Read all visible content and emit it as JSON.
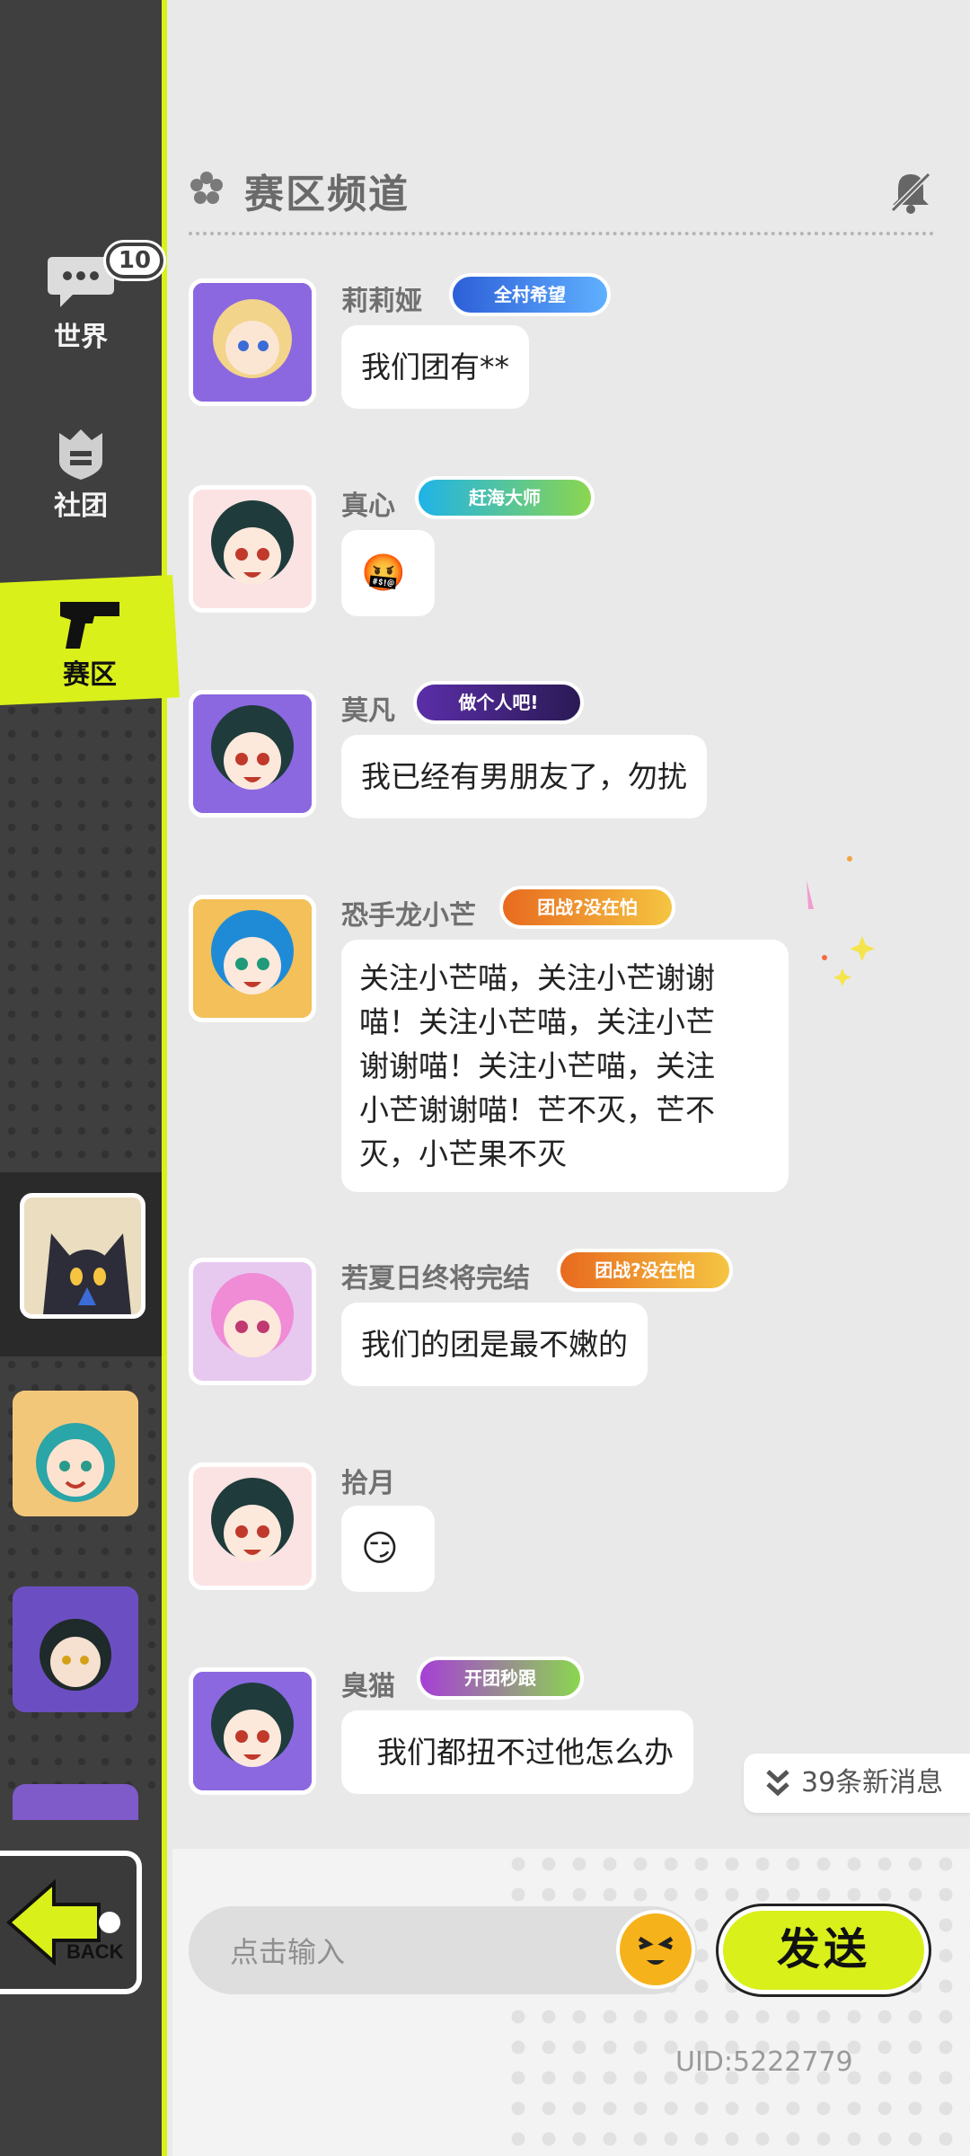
{
  "sidebar": {
    "nav": [
      {
        "label": "世界",
        "badge": "10"
      },
      {
        "label": "社团"
      },
      {
        "label": "赛区"
      }
    ],
    "back_label": "BACK"
  },
  "header": {
    "title": "赛区频道"
  },
  "messages": [
    {
      "name": "莉莉娅",
      "medal": "全村希望",
      "text": "我们团有**"
    },
    {
      "name": "真心",
      "medal": "赶海大师",
      "emoji": "🤬"
    },
    {
      "name": "莫凡",
      "medal": "做个人吧!",
      "text": "我已经有男朋友了，勿扰"
    },
    {
      "name": "恐手龙小芒",
      "medal": "团战?没在怕",
      "text_lines": [
        "关注小芒喵，关注小芒谢谢",
        "喵！关注小芒喵，关注小芒",
        "谢谢喵！关注小芒喵，关注",
        "小芒谢谢喵！芒不灭，芒不",
        "灭，小芒果不灭"
      ]
    },
    {
      "name": "若夏日终将完结",
      "medal": "团战?没在怕",
      "text": "我们的团是最不嫩的"
    },
    {
      "name": "拾月",
      "emoji": "😏"
    },
    {
      "name": "臭猫",
      "medal": "开团秒跟",
      "text": "我们都扭不过他怎么办"
    }
  ],
  "new_messages": "39条新消息",
  "input": {
    "placeholder": "点击输入"
  },
  "send_label": "发送",
  "uid": "UID:5222779",
  "colors": {
    "accent": "#d9f01b",
    "sidebar": "#3f3f3f",
    "background": "#e9e9e9"
  }
}
